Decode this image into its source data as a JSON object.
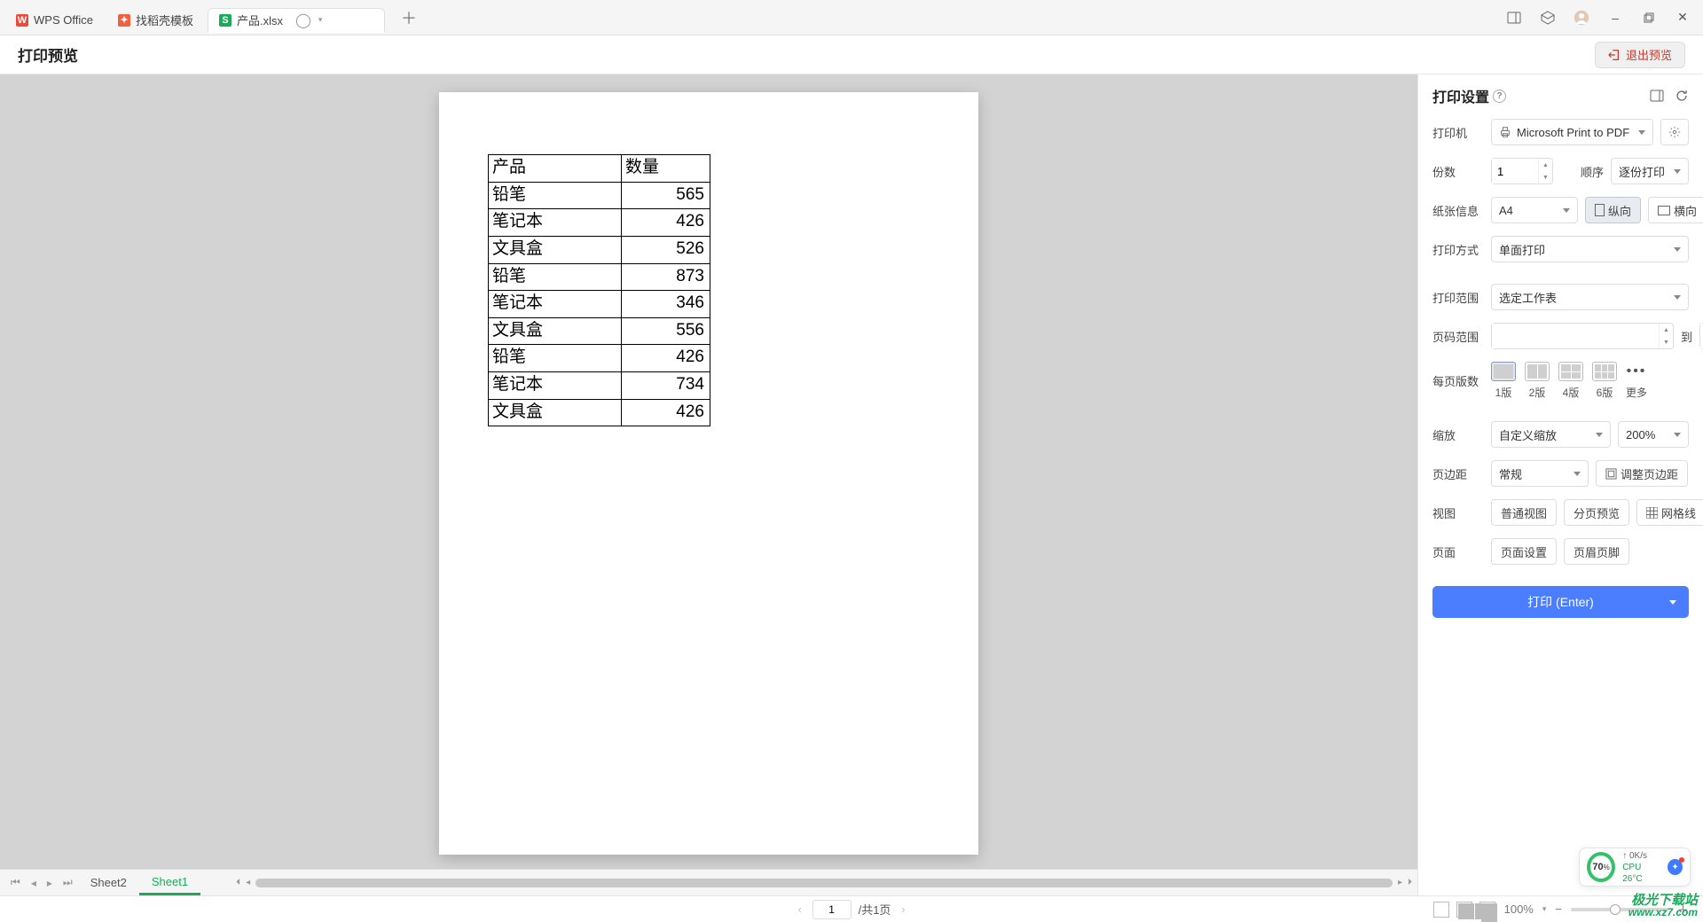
{
  "titlebar": {
    "tabs": [
      {
        "label": "WPS Office"
      },
      {
        "label": "找稻壳模板"
      },
      {
        "label": "产品.xlsx"
      }
    ]
  },
  "subheader": {
    "title": "打印预览",
    "exit": "退出预览"
  },
  "table": {
    "headers": [
      "产品",
      "数量"
    ],
    "rows": [
      [
        "铅笔",
        "565"
      ],
      [
        "笔记本",
        "426"
      ],
      [
        "文具盒",
        "526"
      ],
      [
        "铅笔",
        "873"
      ],
      [
        "笔记本",
        "346"
      ],
      [
        "文具盒",
        "556"
      ],
      [
        "铅笔",
        "426"
      ],
      [
        "笔记本",
        "734"
      ],
      [
        "文具盒",
        "426"
      ]
    ]
  },
  "sheets": {
    "tabs": [
      "Sheet2",
      "Sheet1"
    ],
    "active": "Sheet1"
  },
  "sidebar": {
    "title": "打印设置",
    "printer": {
      "label": "打印机",
      "value": "Microsoft Print to PDF"
    },
    "copies": {
      "label": "份数",
      "value": "1",
      "order_label": "顺序",
      "order_value": "逐份打印"
    },
    "paper": {
      "label": "纸张信息",
      "size": "A4",
      "portrait": "纵向",
      "landscape": "横向"
    },
    "sides": {
      "label": "打印方式",
      "value": "单面打印"
    },
    "range": {
      "label": "打印范围",
      "value": "选定工作表"
    },
    "pagerange": {
      "label": "页码范围",
      "from": "",
      "to_label": "到",
      "to": ""
    },
    "perpage": {
      "label": "每页版数",
      "opts": [
        "1版",
        "2版",
        "4版",
        "6版"
      ],
      "more": "更多"
    },
    "zoom": {
      "label": "缩放",
      "mode": "自定义缩放",
      "pct": "200%"
    },
    "margin": {
      "label": "页边距",
      "value": "常规",
      "adjust": "调整页边距"
    },
    "view": {
      "label": "视图",
      "normal": "普通视图",
      "pagebreak": "分页预览",
      "grid": "网格线"
    },
    "page": {
      "label": "页面",
      "setup": "页面设置",
      "headerfooter": "页眉页脚"
    },
    "print_btn": "打印 (Enter)"
  },
  "footer": {
    "page_current": "1",
    "page_total": "/共1页",
    "zoom": "100%"
  },
  "perf": {
    "pct": "70",
    "pct_suffix": "%",
    "net": "↑    0K/s",
    "cpu_label": "CPU ",
    "cpu_val": "26°C"
  },
  "watermark": {
    "l1": "极光下载站",
    "l2": "www.xz7.com"
  }
}
